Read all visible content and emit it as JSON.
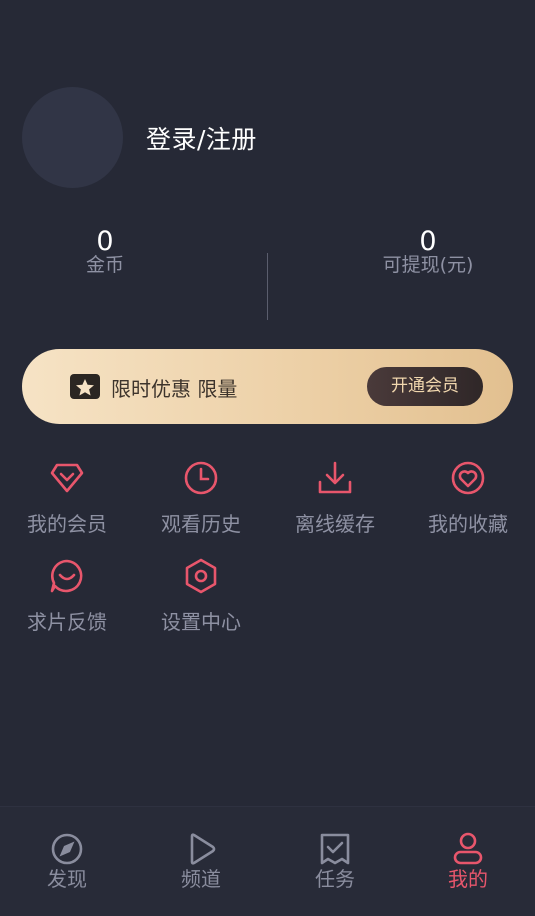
{
  "profile": {
    "login_label": "登录/注册"
  },
  "stats": {
    "coins": {
      "value": "0",
      "label": "金币"
    },
    "withdrawable": {
      "value": "0",
      "label": "可提现(元)"
    }
  },
  "vip_banner": {
    "text": "限时优惠 限量",
    "button_label": "开通会员"
  },
  "menu": {
    "items": [
      {
        "label": "我的会员",
        "icon": "diamond-icon"
      },
      {
        "label": "观看历史",
        "icon": "clock-icon"
      },
      {
        "label": "离线缓存",
        "icon": "download-icon"
      },
      {
        "label": "我的收藏",
        "icon": "heart-icon"
      },
      {
        "label": "求片反馈",
        "icon": "feedback-icon"
      },
      {
        "label": "设置中心",
        "icon": "settings-icon"
      }
    ]
  },
  "tabbar": {
    "items": [
      {
        "label": "发现",
        "icon": "compass-icon"
      },
      {
        "label": "频道",
        "icon": "play-icon"
      },
      {
        "label": "任务",
        "icon": "task-icon"
      },
      {
        "label": "我的",
        "icon": "user-icon"
      }
    ],
    "active_index": 3
  },
  "colors": {
    "accent": "#e8566c",
    "background": "#262936",
    "vip_gold": "#ecd0a6"
  }
}
